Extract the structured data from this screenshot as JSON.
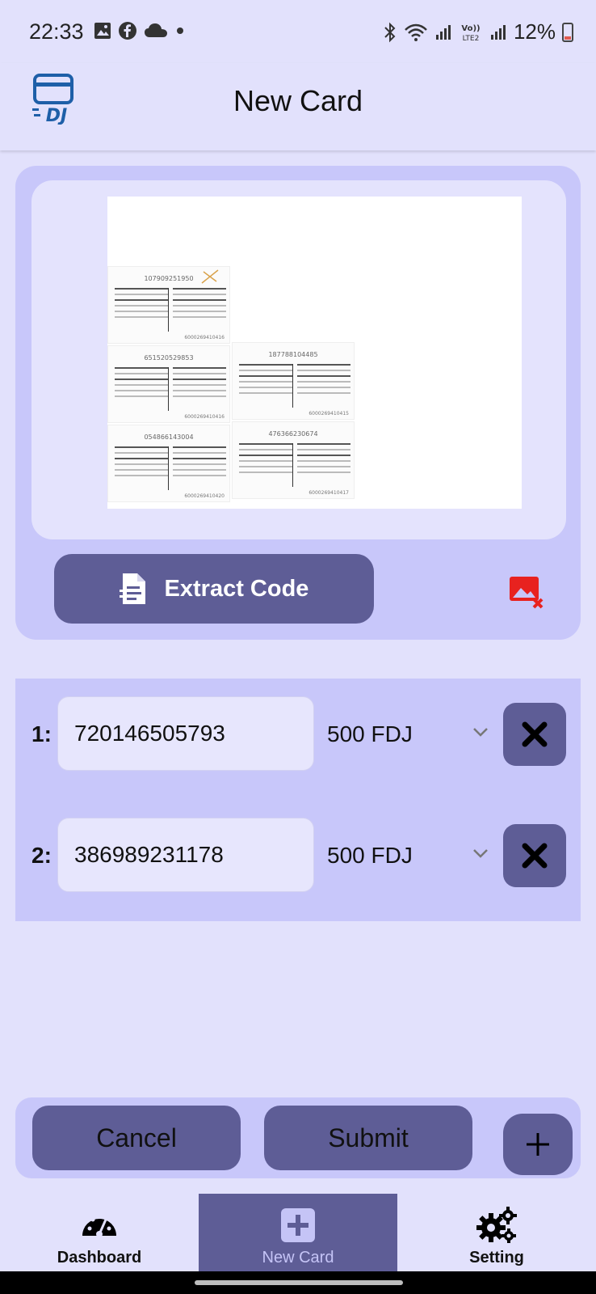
{
  "status_bar": {
    "time": "22:33",
    "battery": "12%",
    "left_icons": [
      "gallery-icon",
      "facebook-icon",
      "cloud-icon",
      "dot-icon"
    ],
    "right_icons": [
      "bluetooth-icon",
      "wifi-icon",
      "signal-icon",
      "volte-icon",
      "signal-icon",
      "battery-icon"
    ],
    "volte_label": "Vo)) LTE2"
  },
  "app_bar": {
    "title": "New Card",
    "logo_text": "DJ"
  },
  "image_panel": {
    "extract_label": "Extract Code",
    "scan_serials": [
      "107909251950",
      "651520529853",
      "187788104485",
      "054866143004",
      "476366230674"
    ]
  },
  "codes": [
    {
      "index": "1:",
      "code": "720146505793",
      "amount": "500 FDJ"
    },
    {
      "index": "2:",
      "code": "386989231178",
      "amount": "500 FDJ"
    }
  ],
  "actions": {
    "cancel_label": "Cancel",
    "submit_label": "Submit"
  },
  "nav": {
    "items": [
      {
        "label": "Dashboard"
      },
      {
        "label": "New Card"
      },
      {
        "label": "Setting"
      }
    ],
    "active": "New Card"
  },
  "colors": {
    "background": "#e2e1fc",
    "panel": "#c8c7fa",
    "accent": "#5e5d96",
    "danger": "#e8221f",
    "logo_blue": "#1e5fa8"
  }
}
